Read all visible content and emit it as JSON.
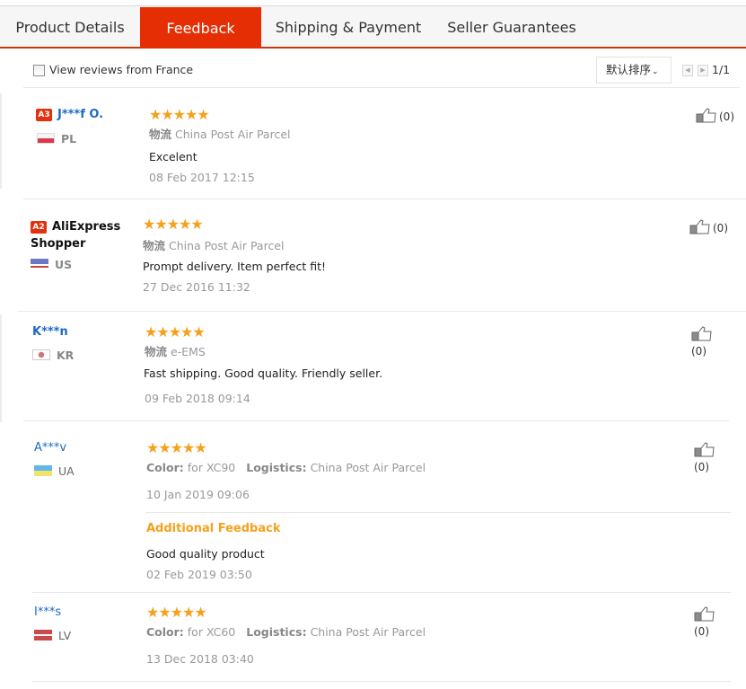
{
  "tabs": [
    {
      "label": "Product Details",
      "active": false
    },
    {
      "label": "Feedback",
      "active": true
    },
    {
      "label": "Shipping & Payment",
      "active": false
    },
    {
      "label": "Seller Guarantees",
      "active": false
    }
  ],
  "filter": {
    "checkbox_label": "View reviews from France",
    "checked": false,
    "sort_label": "默认排序",
    "page": "1/1"
  },
  "colors": {
    "accent": "#e62e04",
    "star": "#f6a11b",
    "link": "#1c6ac4"
  },
  "reviews": [
    {
      "level": "A3",
      "name": "J***f O.",
      "country": "PL",
      "stars": "★★★★★",
      "rating": 5,
      "logistics_label": "物流",
      "logistics": "China Post Air Parcel",
      "content": "Excelent",
      "date": "08 Feb 2017 12:15",
      "helpful": "(0)"
    },
    {
      "level": "A2",
      "name": "AliExpress",
      "name_line2": "Shopper",
      "country": "US",
      "stars": "★★★★★",
      "rating": 5,
      "logistics_label": "物流",
      "logistics": "China Post Air Parcel",
      "content": "Prompt delivery. Item perfect fit!",
      "date": "27 Dec 2016 11:32",
      "helpful": "(0)"
    },
    {
      "name": "K***n",
      "country": "KR",
      "stars": "★★★★★",
      "rating": 5,
      "logistics_label": "物流",
      "logistics": "e-EMS",
      "content": "Fast shipping. Good quality. Friendly seller.",
      "date": "09 Feb 2018 09:14",
      "helpful": "(0)"
    },
    {
      "name": "A***v",
      "country": "UA",
      "stars": "★★★★★",
      "rating": 5,
      "color_label": "Color:",
      "color": "for XC90",
      "logistics_label": "Logistics:",
      "logistics": "China Post Air Parcel",
      "date": "10 Jan 2019 09:06",
      "additional_title": "Additional Feedback",
      "additional_content": "Good quality product",
      "additional_date": "02 Feb 2019 03:50",
      "helpful": "(0)"
    },
    {
      "name": "I***s",
      "country": "LV",
      "stars": "★★★★★",
      "rating": 5,
      "color_label": "Color:",
      "color": "for XC60",
      "logistics_label": "Logistics:",
      "logistics": "China Post Air Parcel",
      "date": "13 Dec 2018 03:40",
      "helpful": "(0)"
    }
  ]
}
